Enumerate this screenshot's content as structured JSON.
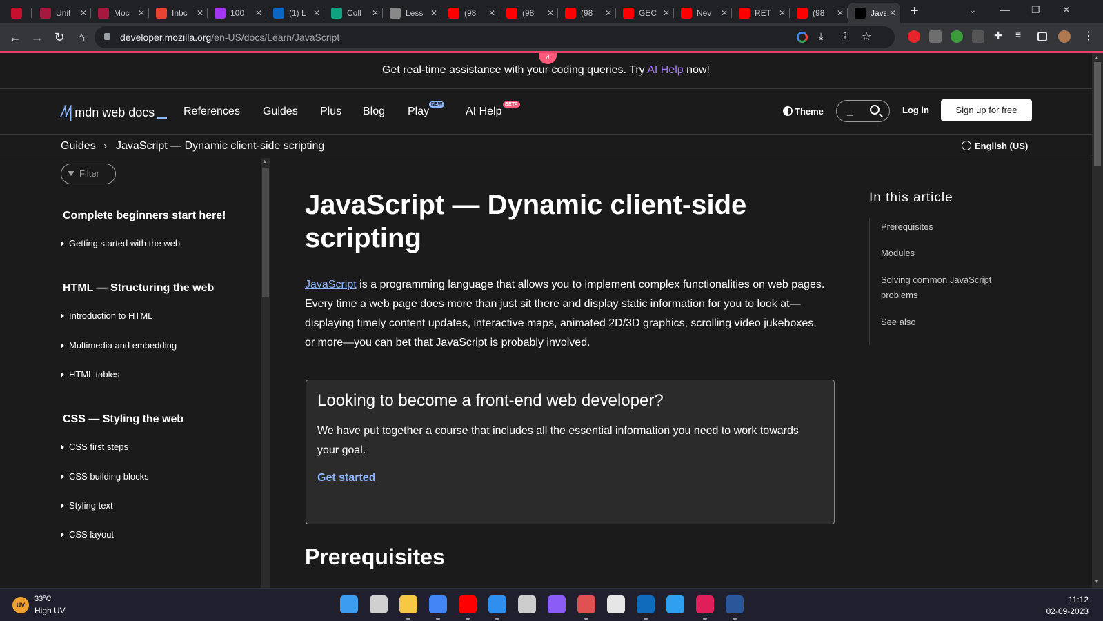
{
  "browser": {
    "tabs": [
      {
        "title": "",
        "icon": "asu-icon",
        "color": "#c8102e"
      },
      {
        "title": "Unit",
        "icon": "coursera-icon",
        "color": "#a4193d"
      },
      {
        "title": "Moc",
        "icon": "coursera-icon",
        "color": "#a4193d"
      },
      {
        "title": "Inbc",
        "icon": "gmail-icon",
        "color": "#ea4335"
      },
      {
        "title": "100",
        "icon": "udemy-icon",
        "color": "#a435f0"
      },
      {
        "title": "(1) L",
        "icon": "linkedin-icon",
        "color": "#0a66c2"
      },
      {
        "title": "Coll",
        "icon": "chatgpt-icon",
        "color": "#10a37f"
      },
      {
        "title": "Less",
        "icon": "codepen-icon",
        "color": "#888888"
      },
      {
        "title": "(98",
        "icon": "youtube-icon",
        "color": "#ff0000"
      },
      {
        "title": "(98",
        "icon": "youtube-icon",
        "color": "#ff0000"
      },
      {
        "title": "(98",
        "icon": "youtube-icon",
        "color": "#ff0000"
      },
      {
        "title": "GEC",
        "icon": "youtube-icon",
        "color": "#ff0000"
      },
      {
        "title": "Nev",
        "icon": "youtube-icon",
        "color": "#ff0000"
      },
      {
        "title": "RET",
        "icon": "youtube-icon",
        "color": "#ff0000"
      },
      {
        "title": "(98",
        "icon": "youtube-icon",
        "color": "#ff0000"
      },
      {
        "title": "Java",
        "icon": "mdn-icon",
        "color": "#000000",
        "active": true
      }
    ],
    "url_host": "developer.mozilla.org",
    "url_path": "/en-US/docs/Learn/JavaScript"
  },
  "banner": {
    "text_before": "Get real-time assistance with your coding queries. Try ",
    "link": "AI Help",
    "text_after": " now!"
  },
  "header": {
    "logo": "mdn web docs",
    "nav": [
      "References",
      "Guides",
      "Plus",
      "Blog",
      "Play",
      "AI Help"
    ],
    "play_badge": "NEW",
    "ai_badge": "BETA",
    "theme": "Theme",
    "search_placeholder": "_",
    "login": "Log in",
    "signup": "Sign up for free"
  },
  "breadcrumb": {
    "parent": "Guides",
    "current": "JavaScript — Dynamic client-side scripting",
    "language": "English (US)"
  },
  "sidebar": {
    "filter_placeholder": "Filter",
    "sections": [
      {
        "heading": "Complete beginners start here!",
        "items": [
          "Getting started with the web"
        ]
      },
      {
        "heading": "HTML — Structuring the web",
        "items": [
          "Introduction to HTML",
          "Multimedia and embedding",
          "HTML tables"
        ]
      },
      {
        "heading": "CSS — Styling the web",
        "items": [
          "CSS first steps",
          "CSS building blocks",
          "Styling text",
          "CSS layout"
        ]
      }
    ]
  },
  "main": {
    "title": "JavaScript — Dynamic client-side scripting",
    "intro_link": "JavaScript",
    "intro_text": " is a programming language that allows you to implement complex functionalities on web pages. Every time a web page does more than just sit there and display static information for you to look at—displaying timely content updates, interactive maps, animated 2D/3D graphics, scrolling video jukeboxes, or more—you can bet that JavaScript is probably involved.",
    "callout": {
      "heading": "Looking to become a front-end web developer?",
      "body": "We have put together a course that includes all the essential information you need to work towards your goal.",
      "link": "Get started"
    },
    "next_heading": "Prerequisites"
  },
  "toc": {
    "title": "In this article",
    "items": [
      "Prerequisites",
      "Modules",
      "Solving common JavaScript problems",
      "See also"
    ]
  },
  "taskbar": {
    "temperature": "33°C",
    "uv": "High UV",
    "time": "11:12",
    "date": "02-09-2023",
    "apps": [
      {
        "name": "start-icon",
        "color": "#3c9cf0"
      },
      {
        "name": "task-view-icon",
        "color": "#d0d0d0"
      },
      {
        "name": "file-explorer-icon",
        "color": "#f6c844"
      },
      {
        "name": "chrome-icon",
        "color": "#4285f4"
      },
      {
        "name": "youtube-music-icon",
        "color": "#ff0000"
      },
      {
        "name": "vscode-icon",
        "color": "#2f8ff0"
      },
      {
        "name": "unity-icon",
        "color": "#cccccc"
      },
      {
        "name": "github-desktop-icon",
        "color": "#8a5cf5"
      },
      {
        "name": "snipping-tool-icon",
        "color": "#e05050"
      },
      {
        "name": "dell-icon",
        "color": "#e6e6e6"
      },
      {
        "name": "outlook-icon",
        "color": "#0f6cbd"
      },
      {
        "name": "wave-icon",
        "color": "#2fa0f0"
      },
      {
        "name": "slack-icon",
        "color": "#e01e5a"
      },
      {
        "name": "word-icon",
        "color": "#2b579a"
      }
    ]
  }
}
